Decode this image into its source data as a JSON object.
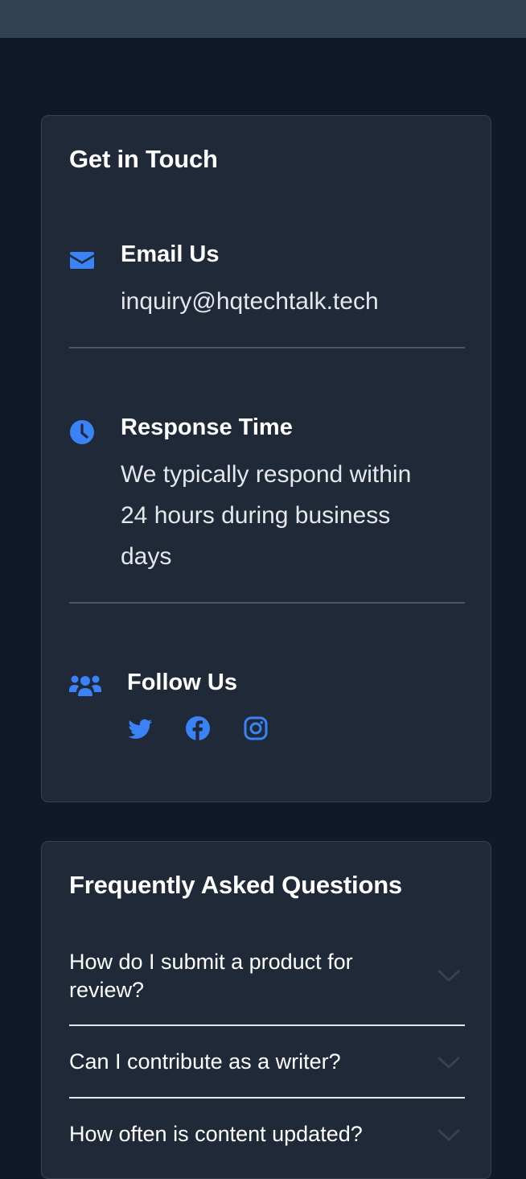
{
  "colors": {
    "background": "#111827",
    "card": "#1f2937",
    "accent": "#3b82f6",
    "topbar": "#334155"
  },
  "contact": {
    "title": "Get in Touch",
    "email": {
      "icon": "envelope-icon",
      "heading": "Email Us",
      "value": "inquiry@hqtechtalk.tech"
    },
    "response": {
      "icon": "clock-icon",
      "heading": "Response Time",
      "line1": "We typically respond within",
      "line2": "24 hours during business",
      "line3": "days"
    },
    "follow": {
      "icon": "users-icon",
      "heading": "Follow Us",
      "social": [
        "twitter-icon",
        "facebook-icon",
        "instagram-icon"
      ]
    }
  },
  "faq": {
    "title": "Frequently Asked Questions",
    "items": [
      {
        "line1": "How do I submit a product for",
        "line2": "review?"
      },
      {
        "line1": "Can I contribute as a writer?"
      },
      {
        "line1": "How often is content updated?"
      }
    ]
  }
}
